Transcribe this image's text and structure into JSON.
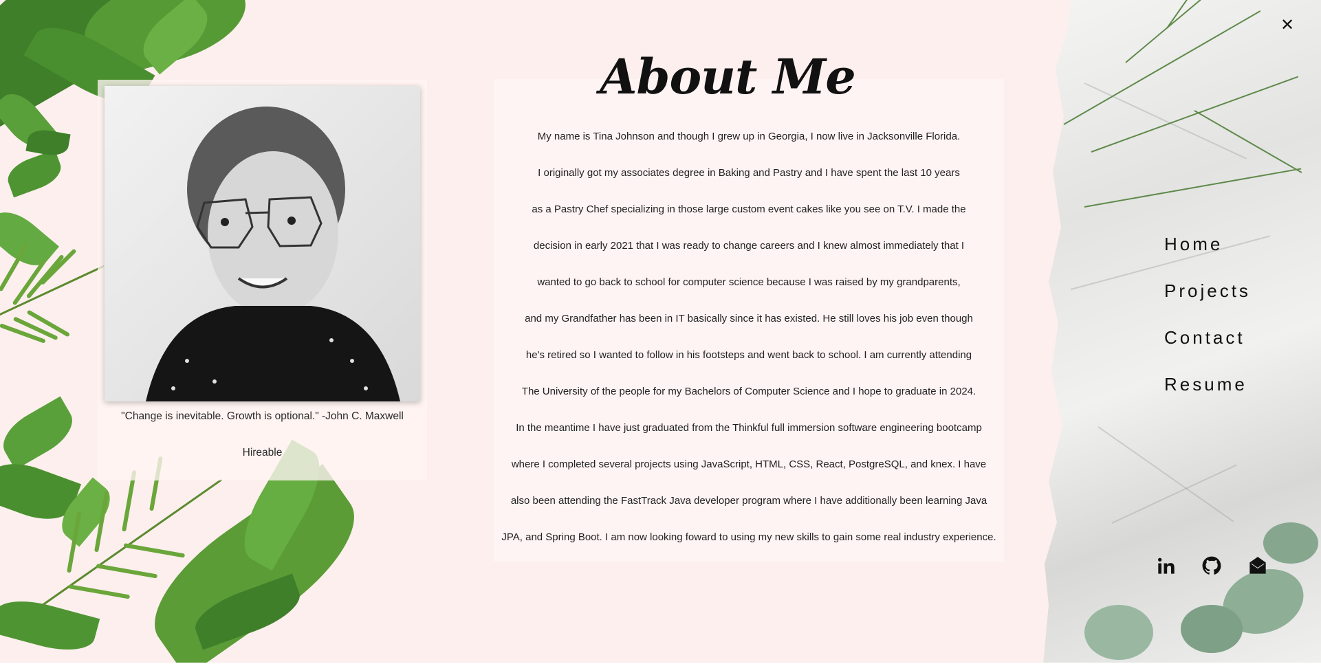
{
  "about": {
    "title": "About Me",
    "lines": [
      "My name is Tina Johnson and though I grew up in Georgia, I now live in Jacksonville Florida.",
      "I originally got my associates degree in Baking and Pastry and I have spent the last 10 years",
      "as a Pastry Chef specializing in those large custom event cakes like you see on T.V. I made the",
      "decision in early 2021 that I was ready to change careers and I knew almost immediately that I",
      "wanted to go back to school for computer science because I was raised by my grandparents,",
      "and my Grandfather has been in IT basically since it has existed. He still loves his job even though",
      "he's retired so I wanted to follow in his footsteps and went back to school. I am currently attending",
      "The University of the people for my Bachelors of Computer Science and I hope to graduate in 2024.",
      "In the meantime I have just graduated from the Thinkful full immersion software engineering bootcamp",
      "where I completed several projects using JavaScript, HTML, CSS, React, PostgreSQL, and knex. I have",
      "also been attending the FastTrack Java developer program where I have additionally been learning Java",
      "JPA, and Spring Boot. I am now looking foward to using my new skills to gain some real industry experience."
    ]
  },
  "profile": {
    "quote": "\"Change is inevitable. Growth is optional.\" -John C. Maxwell",
    "status": "Hireable"
  },
  "nav": {
    "close_icon": "close-icon",
    "items": [
      "Home",
      "Projects",
      "Contact",
      "Resume"
    ]
  },
  "social": {
    "icons": [
      "linkedin-icon",
      "github-icon",
      "email-icon"
    ]
  },
  "colors": {
    "background": "#fcefed",
    "card": "#fff5f4",
    "text": "#1e1e1e",
    "leaf_green": "#4f9a32"
  }
}
